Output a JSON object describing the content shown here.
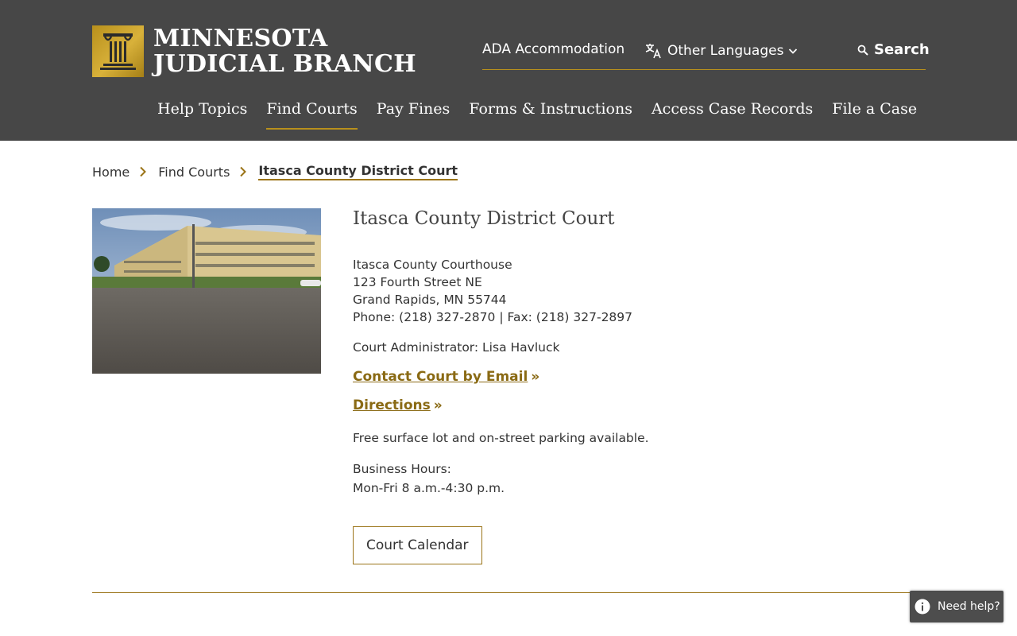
{
  "header": {
    "logo": {
      "line1": "MINNESOTA",
      "line2": "JUDICIAL BRANCH"
    },
    "utility": {
      "ada": "ADA Accommodation",
      "languages": "Other Languages",
      "search": "Search"
    },
    "nav": [
      {
        "label": "Help Topics",
        "active": false
      },
      {
        "label": "Find Courts",
        "active": true
      },
      {
        "label": "Pay Fines",
        "active": false
      },
      {
        "label": "Forms & Instructions",
        "active": false
      },
      {
        "label": "Access Case Records",
        "active": false
      },
      {
        "label": "File a Case",
        "active": false
      }
    ]
  },
  "breadcrumb": [
    "Home",
    "Find Courts",
    "Itasca County District Court"
  ],
  "court": {
    "title": "Itasca County District Court",
    "address": [
      "Itasca County Courthouse",
      "123 Fourth Street NE",
      "Grand Rapids, MN 55744"
    ],
    "phone_fax": "Phone: (218) 327-2870 | Fax: (218) 327-2897",
    "administrator": "Court Administrator: Lisa Havluck",
    "contact_link": "Contact Court by Email",
    "directions_link": "Directions",
    "link_suffix": "»",
    "parking": "Free surface lot and on-street parking available.",
    "hours_label": "Business Hours:",
    "hours": "Mon-Fri 8 a.m.-4:30 p.m.",
    "calendar_button": "Court Calendar"
  },
  "help_widget": {
    "label": "Need help?"
  },
  "colors": {
    "header_bg": "#474747",
    "accent_gold": "#b8901c",
    "link": "#8a6a14"
  }
}
